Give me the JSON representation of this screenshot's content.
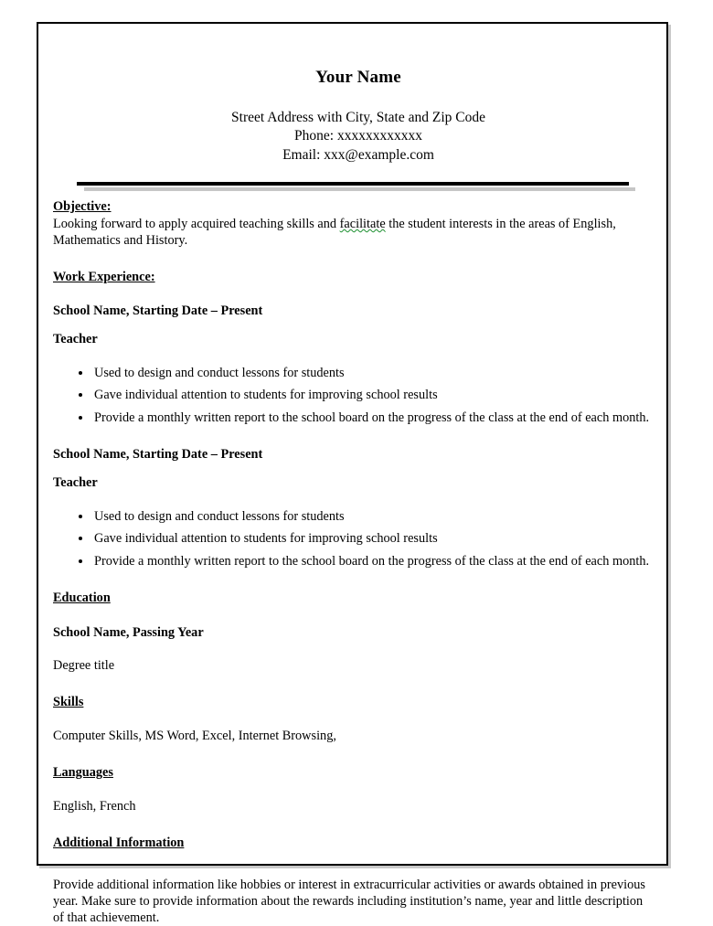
{
  "document": {
    "header": {
      "name": "Your Name",
      "address": "Street Address with City, State and Zip Code",
      "phone": "Phone: xxxxxxxxxxxx",
      "email": "Email: xxx@example.com"
    },
    "objective": {
      "heading": "Objective:",
      "text_before": "Looking forward to apply acquired teaching skills and ",
      "flagged_word": "facilitate",
      "text_after": " the student interests in the areas of English, Mathematics and History."
    },
    "work_experience": {
      "heading": "Work Experience:",
      "entries": [
        {
          "employer_line": "School Name, Starting Date – Present",
          "job_title": "Teacher",
          "bullets": [
            "Used to design and conduct lessons for students",
            "Gave individual attention to students for improving school results",
            "Provide a monthly written report to the school board on the progress of the class at the end of each month."
          ]
        },
        {
          "employer_line": "School Name, Starting Date – Present",
          "job_title": "Teacher",
          "bullets": [
            "Used to design and conduct lessons for students",
            "Gave individual attention to students for improving school results",
            "Provide a monthly written report to the school board on the progress of the class at the end of each month."
          ]
        }
      ]
    },
    "education": {
      "heading": "Education",
      "school_line": "School Name, Passing Year",
      "degree": "Degree title"
    },
    "skills": {
      "heading": "Skills",
      "text": "Computer Skills, MS Word, Excel, Internet Browsing,"
    },
    "languages": {
      "heading": "Languages",
      "text": "English, French"
    },
    "additional_information": {
      "heading": "Additional Information",
      "text": "Provide additional information like hobbies or interest in extracurricular activities or awards obtained in previous year. Make sure to provide information about the rewards including institution’s name, year and little description of that achievement."
    }
  }
}
